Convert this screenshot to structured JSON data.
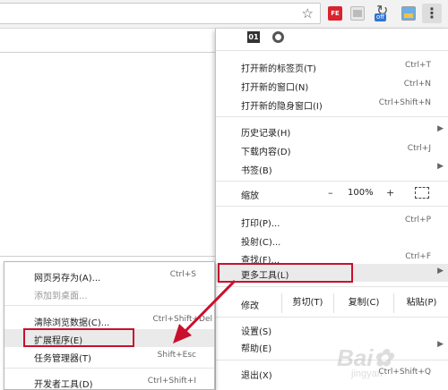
{
  "toolbar": {
    "ext_fe_label": "FE",
    "ext_off_badge": "off"
  },
  "menu": {
    "icon_tile_label": "01",
    "items": [
      {
        "label": "打开新的标签页(T)",
        "shortcut": "Ctrl+T"
      },
      {
        "label": "打开新的窗口(N)",
        "shortcut": "Ctrl+N"
      },
      {
        "label": "打开新的隐身窗口(I)",
        "shortcut": "Ctrl+Shift+N"
      },
      {
        "label": "历史记录(H)",
        "shortcut": ""
      },
      {
        "label": "下载内容(D)",
        "shortcut": "Ctrl+J"
      },
      {
        "label": "书签(B)",
        "shortcut": ""
      }
    ],
    "zoom": {
      "label": "缩放",
      "minus": "–",
      "value": "100%",
      "plus": "+"
    },
    "items2": [
      {
        "label": "打印(P)...",
        "shortcut": "Ctrl+P"
      },
      {
        "label": "投射(C)...",
        "shortcut": ""
      },
      {
        "label": "查找(F)...",
        "shortcut": "Ctrl+F"
      }
    ],
    "more_tools": "更多工具(L)",
    "edit": {
      "label": "修改",
      "cut": "剪切(T)",
      "copy": "复制(C)",
      "paste": "粘贴(P)"
    },
    "settings": "设置(S)",
    "help": "帮助(E)",
    "exit": {
      "label": "退出(X)",
      "shortcut": "Ctrl+Shift+Q"
    }
  },
  "submenu": {
    "items": [
      {
        "label": "网页另存为(A)...",
        "shortcut": "Ctrl+S"
      },
      {
        "label": "添加到桌面...",
        "shortcut": ""
      },
      {
        "label": "清除浏览数据(C)...",
        "shortcut": "Ctrl+Shift+Del"
      },
      {
        "label": "扩展程序(E)",
        "shortcut": ""
      },
      {
        "label": "任务管理器(T)",
        "shortcut": "Shift+Esc"
      },
      {
        "label": "开发者工具(D)",
        "shortcut": "Ctrl+Shift+I"
      }
    ]
  },
  "watermark": {
    "brand": "Bai",
    "sub": "jingyan"
  },
  "colors": {
    "highlight_red": "#c8102e",
    "hover_bg": "#eaeaea"
  }
}
